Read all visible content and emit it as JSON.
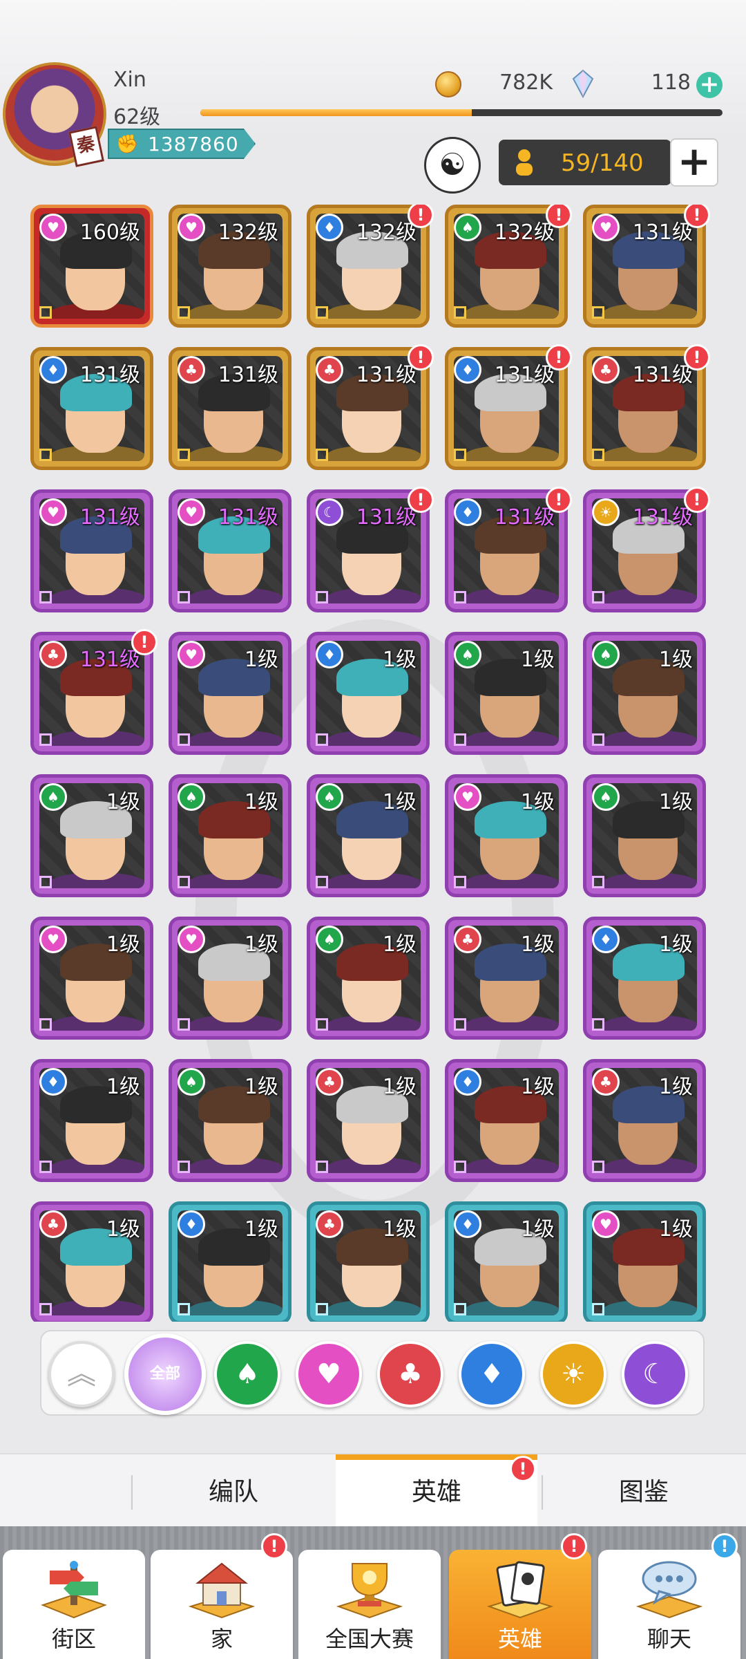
{
  "player": {
    "name": "Xin",
    "level": "62级",
    "tag": "秦",
    "power": "1387860",
    "gold": "782K",
    "gems": "118",
    "exp_progress": 0.52
  },
  "hero_count": "59/140",
  "icons": {
    "power": "fist-icon",
    "gold": "gold-coin-icon",
    "gem": "gem-icon",
    "mentor": "mentor-icon",
    "person": "person-icon",
    "add": "plus-icon"
  },
  "heroes": [
    {
      "level": "160级",
      "faction": "heart",
      "frame": "red",
      "alert": false
    },
    {
      "level": "132级",
      "faction": "heart",
      "frame": "gold",
      "alert": false
    },
    {
      "level": "132级",
      "faction": "diamond",
      "frame": "gold",
      "alert": true
    },
    {
      "level": "132级",
      "faction": "spade",
      "frame": "gold",
      "alert": true
    },
    {
      "level": "131级",
      "faction": "heart",
      "frame": "gold",
      "alert": true
    },
    {
      "level": "131级",
      "faction": "diamond",
      "frame": "gold",
      "alert": false
    },
    {
      "level": "131级",
      "faction": "club",
      "frame": "gold",
      "alert": false
    },
    {
      "level": "131级",
      "faction": "club",
      "frame": "gold",
      "alert": true
    },
    {
      "level": "131级",
      "faction": "diamond",
      "frame": "gold",
      "alert": true
    },
    {
      "level": "131级",
      "faction": "club",
      "frame": "gold",
      "alert": true
    },
    {
      "level": "131级",
      "faction": "heart",
      "frame": "purple",
      "alert": false
    },
    {
      "level": "131级",
      "faction": "heart",
      "frame": "purple",
      "alert": false
    },
    {
      "level": "131级",
      "faction": "moon",
      "frame": "purple",
      "alert": true
    },
    {
      "level": "131级",
      "faction": "diamond",
      "frame": "purple",
      "alert": true
    },
    {
      "level": "131级",
      "faction": "sun",
      "frame": "purple",
      "alert": true
    },
    {
      "level": "131级",
      "faction": "club",
      "frame": "purple",
      "alert": true
    },
    {
      "level": "1级",
      "faction": "heart",
      "frame": "purple",
      "alert": false
    },
    {
      "level": "1级",
      "faction": "diamond",
      "frame": "purple",
      "alert": false
    },
    {
      "level": "1级",
      "faction": "spade",
      "frame": "purple",
      "alert": false
    },
    {
      "level": "1级",
      "faction": "spade",
      "frame": "purple",
      "alert": false
    },
    {
      "level": "1级",
      "faction": "spade",
      "frame": "purple",
      "alert": false
    },
    {
      "level": "1级",
      "faction": "spade",
      "frame": "purple",
      "alert": false
    },
    {
      "level": "1级",
      "faction": "spade",
      "frame": "purple",
      "alert": false
    },
    {
      "level": "1级",
      "faction": "heart",
      "frame": "purple",
      "alert": false
    },
    {
      "level": "1级",
      "faction": "spade",
      "frame": "purple",
      "alert": false
    },
    {
      "level": "1级",
      "faction": "heart",
      "frame": "purple",
      "alert": false
    },
    {
      "level": "1级",
      "faction": "heart",
      "frame": "purple",
      "alert": false
    },
    {
      "level": "1级",
      "faction": "spade",
      "frame": "purple",
      "alert": false
    },
    {
      "level": "1级",
      "faction": "club",
      "frame": "purple",
      "alert": false
    },
    {
      "level": "1级",
      "faction": "diamond",
      "frame": "purple",
      "alert": false
    },
    {
      "level": "1级",
      "faction": "diamond",
      "frame": "purple",
      "alert": false
    },
    {
      "level": "1级",
      "faction": "spade",
      "frame": "purple",
      "alert": false
    },
    {
      "level": "1级",
      "faction": "club",
      "frame": "purple",
      "alert": false
    },
    {
      "level": "1级",
      "faction": "diamond",
      "frame": "purple",
      "alert": false
    },
    {
      "level": "1级",
      "faction": "club",
      "frame": "purple",
      "alert": false
    },
    {
      "level": "1级",
      "faction": "club",
      "frame": "purple",
      "alert": false
    },
    {
      "level": "1级",
      "faction": "diamond",
      "frame": "teal",
      "alert": false
    },
    {
      "level": "1级",
      "faction": "club",
      "frame": "teal",
      "alert": false
    },
    {
      "level": "1级",
      "faction": "diamond",
      "frame": "teal",
      "alert": false
    },
    {
      "level": "1级",
      "faction": "heart",
      "frame": "teal",
      "alert": false
    }
  ],
  "filters": {
    "all_label": "全部",
    "items": [
      "scroll-up-icon",
      "all-factions",
      "spade-filter",
      "heart-filter",
      "club-filter",
      "diamond-filter",
      "sun-filter",
      "moon-filter"
    ]
  },
  "tabs": {
    "formation": "编队",
    "heroes": "英雄",
    "gallery": "图鉴"
  },
  "nav": {
    "street": "街区",
    "home": "家",
    "tournament": "全国大赛",
    "heroes": "英雄",
    "chat": "聊天"
  },
  "badges": {
    "alert": "!"
  }
}
